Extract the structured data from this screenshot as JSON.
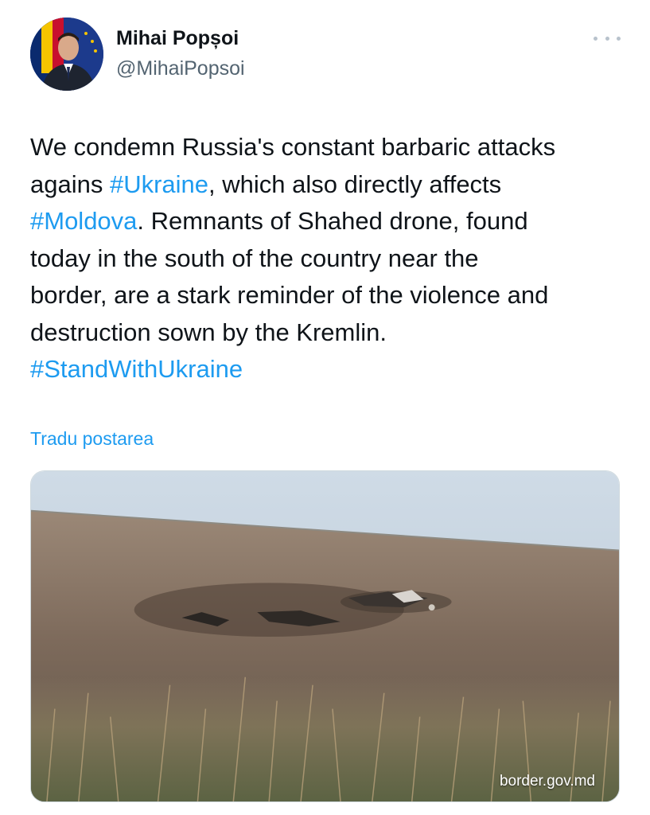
{
  "author": {
    "display_name": "Mihai Popșoi",
    "handle": "@MihaiPopsoi",
    "avatar": "profile-photo"
  },
  "more_icon": "ellipsis-icon",
  "post": {
    "lines": [
      [
        {
          "t": "We condemn Russia's constant barbaric attacks"
        }
      ],
      [
        {
          "t": "agains "
        },
        {
          "t": "#Ukraine",
          "tag": true
        },
        {
          "t": ", which also directly affects"
        }
      ],
      [
        {
          "t": "#Moldova",
          "tag": true
        },
        {
          "t": ". Remnants of Shahed drone, found"
        }
      ],
      [
        {
          "t": "today in the south of the country near the"
        }
      ],
      [
        {
          "t": "border, are a stark reminder of the violence and"
        }
      ],
      [
        {
          "t": "destruction sown by the Kremlin."
        }
      ],
      [
        {
          "t": "#StandWithUkraine",
          "tag": true
        }
      ]
    ]
  },
  "translate_label": "Tradu postarea",
  "media": {
    "watermark": "border.gov.md",
    "description_icon": "photo-drone-debris-field"
  },
  "colors": {
    "text": "#0f1419",
    "secondary": "#536471",
    "link": "#1d9bf0"
  }
}
